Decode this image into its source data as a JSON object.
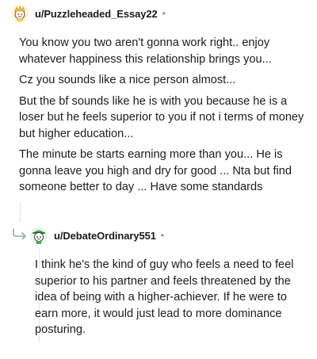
{
  "comments": [
    {
      "username": "u/Puzzleheaded_Essay22",
      "separator": "•",
      "avatar_icon": "avatar-snoo-gold-icon",
      "paragraphs": [
        "You know you two aren't gonna work right.. enjoy whatever happiness this relationship brings you...",
        "Cz you sounds like a nice person almost...",
        "But the bf sounds like he is with you because he is a loser but he feels superior to you if not i terms of money but higher education...",
        "The minute be starts earning more than you... He is gonna leave you high and dry for good ... Nta but find someone better to day ... Have some standards"
      ]
    },
    {
      "username": "u/DebateOrdinary551",
      "separator": "•",
      "avatar_icon": "avatar-snoo-green-icon",
      "reply_icon": "reply-arrow-icon",
      "paragraphs": [
        "I think he's the kind of guy who feels a need to feel superior to his partner and feels threatened by the idea of being with a higher-achiever. If he were to earn more, it would just lead to more dominance posturing."
      ]
    }
  ],
  "colors": {
    "text": "#1c1c1c",
    "meta": "#878a8c",
    "thread_line": "#dfe1e3",
    "avatar_1": "#f2c94c",
    "avatar_2": "#46a758"
  }
}
